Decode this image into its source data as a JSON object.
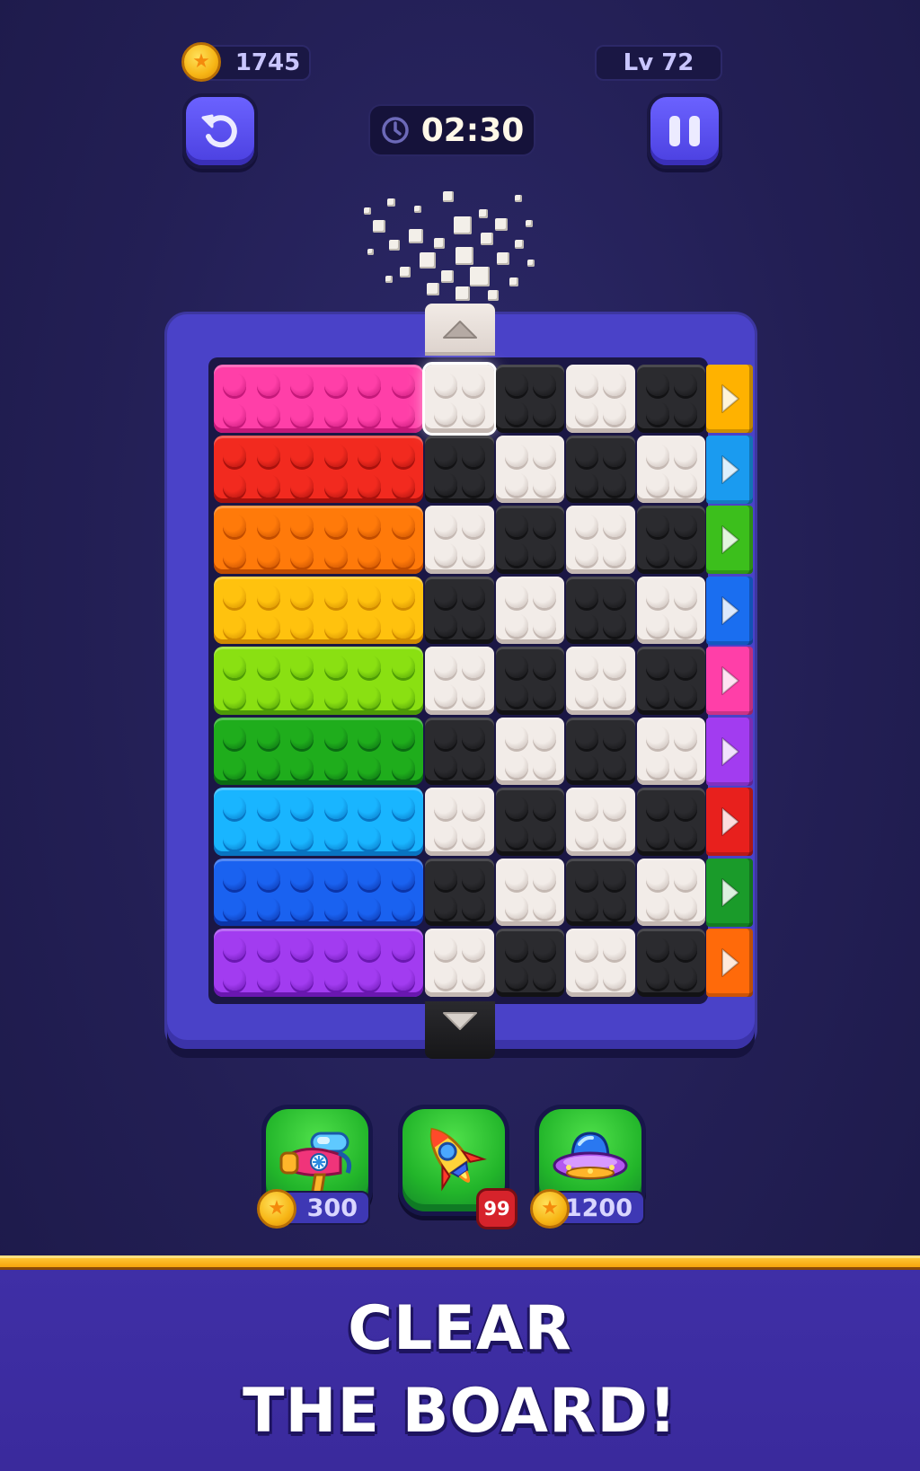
{
  "hud": {
    "coins": "1745",
    "level": "Lv 72",
    "timer": "02:30",
    "undo_icon": "undo-arrow-icon",
    "pause_icon": "pause-icon",
    "clock_icon": "clock-icon"
  },
  "board": {
    "long_bricks": [
      {
        "color": "#ff3fa8",
        "shade": "#c41879"
      },
      {
        "color": "#f22a1f",
        "shade": "#a8110d"
      },
      {
        "color": "#ff7a0a",
        "shade": "#c04c00"
      },
      {
        "color": "#ffc20e",
        "shade": "#d08a00"
      },
      {
        "color": "#8ae012",
        "shade": "#4d9a06"
      },
      {
        "color": "#1fad1c",
        "shade": "#0a6b12"
      },
      {
        "color": "#19b5ff",
        "shade": "#0874c2"
      },
      {
        "color": "#1a62f0",
        "shade": "#0b34a8"
      },
      {
        "color": "#a23cf0",
        "shade": "#6a17b0"
      }
    ],
    "arrow_tiles": [
      {
        "color": "#ffb200"
      },
      {
        "color": "#1a9bf0"
      },
      {
        "color": "#3cbf1c"
      },
      {
        "color": "#1a6ef0"
      },
      {
        "color": "#ff3fa8"
      },
      {
        "color": "#a23cf0"
      },
      {
        "color": "#e8201d"
      },
      {
        "color": "#1a9b2a"
      },
      {
        "color": "#ff6a0a"
      }
    ],
    "checker_pattern": [
      [
        "white",
        "black",
        "white",
        "black"
      ],
      [
        "black",
        "white",
        "black",
        "white"
      ],
      [
        "white",
        "black",
        "white",
        "black"
      ],
      [
        "black",
        "white",
        "black",
        "white"
      ],
      [
        "white",
        "black",
        "white",
        "black"
      ],
      [
        "black",
        "white",
        "black",
        "white"
      ],
      [
        "white",
        "black",
        "white",
        "black"
      ],
      [
        "black",
        "white",
        "black",
        "white"
      ],
      [
        "white",
        "black",
        "white",
        "black"
      ]
    ]
  },
  "boosters": [
    {
      "name": "blaster",
      "icon": "snow-blaster-icon",
      "price": "300"
    },
    {
      "name": "rocket",
      "icon": "rocket-icon",
      "count": "99"
    },
    {
      "name": "ufo",
      "icon": "ufo-icon",
      "price": "1200"
    }
  ],
  "banner": {
    "line1": "CLEAR",
    "line2": "THE BOARD!"
  },
  "colors": {
    "background": "#252159",
    "frame": "#4a42c8",
    "booster_green": "#2cc332",
    "banner": "#3f2fa6",
    "stripe": "#f7a40c"
  }
}
